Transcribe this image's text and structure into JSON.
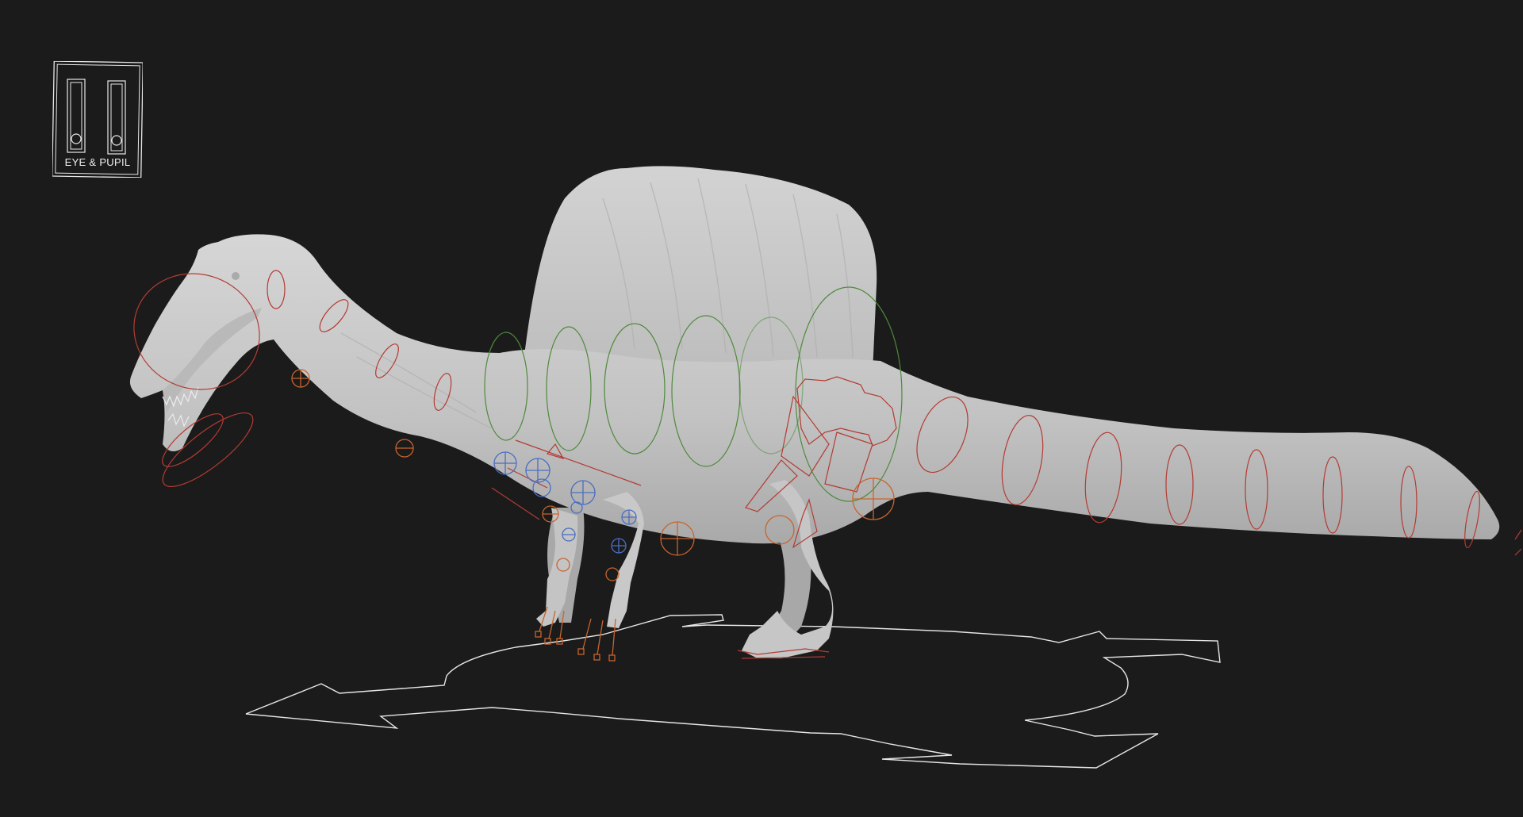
{
  "viewport": {
    "background": "#1b1b1b",
    "model_color": "#c9c9c9",
    "control_colors": {
      "primary": "#b43b33",
      "spine": "#4f8a3c",
      "ik": "#4a6ec2",
      "fk": "#c8642e",
      "ground": "#e6e6e6"
    }
  },
  "logo": {
    "text": "EYE & PUPIL",
    "icon": "eye-pupil-slider-icon"
  }
}
